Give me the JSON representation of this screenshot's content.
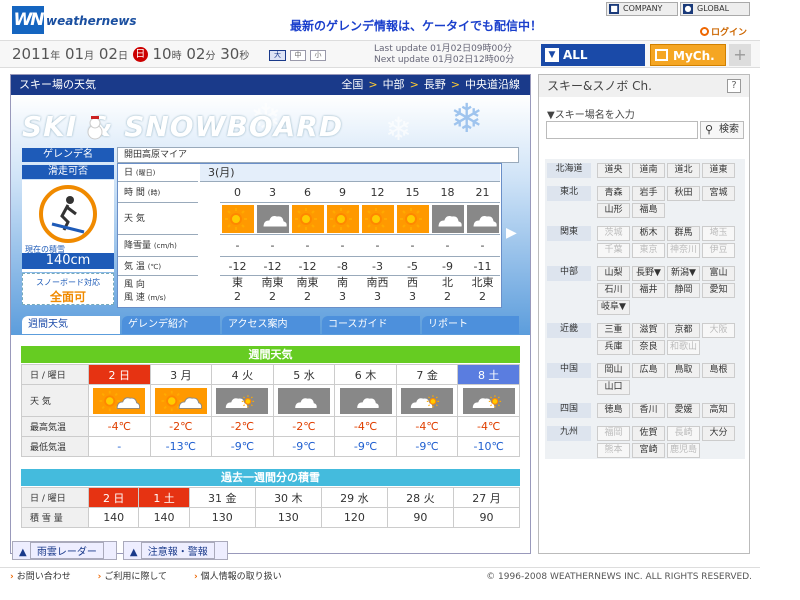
{
  "header": {
    "logo_mark": "WN",
    "logo_text": "weathernews",
    "promo": "最新のゲレンデ情報は、ケータイでも配信中！",
    "company": "COMPANY",
    "global": "GLOBAL",
    "login": "ログイン"
  },
  "datebar": {
    "year": "2011",
    "y_unit": "年",
    "month": "01",
    "m_unit": "月",
    "day": "02",
    "d_unit": "日",
    "weekday": "日",
    "hour": "10",
    "h_unit": "時",
    "minute": "02",
    "mi_unit": "分",
    "second": "30",
    "s_unit": "秒",
    "sizes": [
      "大",
      "中",
      "小"
    ],
    "last_update": "Last update  01月02日09時00分",
    "next_update": "Next update  01月02日12時00分",
    "all_channel": "ALL Channel",
    "mych": "MyCh.",
    "plus": "+"
  },
  "main": {
    "title": "スキー場の天気",
    "crumbs": [
      "全国",
      "中部",
      "長野",
      "中央道沿線"
    ],
    "crumb_sep": ">",
    "banner_title": "SKI & SNOWBOARD",
    "gelande_label": "ゲレンデ名",
    "gelande_name": "開田高原マイア",
    "status_label": "滑走可否",
    "snow_depth_label": "現在の積雪",
    "snow_depth": "140cm",
    "snowboard_label": "スノーボード対応",
    "snowboard_status": "全面可",
    "date_label": "日",
    "date_label_sub": "(曜日)",
    "date_value": "3(月)",
    "time_label": "時 間",
    "time_label_sub": "(時)",
    "hours": [
      "0",
      "3",
      "6",
      "9",
      "12",
      "15",
      "18",
      "21"
    ],
    "weather_label": "天 気",
    "weather": [
      "sunny-icon",
      "cloudy-icon",
      "sunny-icon",
      "sunny-icon",
      "sunny-icon",
      "sunny-icon",
      "cloudy-icon",
      "cloudy-icon"
    ],
    "precip_label": "降雪量",
    "precip_unit": "(cm/h)",
    "precip": [
      "-",
      "-",
      "-",
      "-",
      "-",
      "-",
      "-",
      "-"
    ],
    "temp_label": "気 温",
    "temp_unit": "(℃)",
    "temps": [
      "-12",
      "-12",
      "-12",
      "-8",
      "-3",
      "-5",
      "-9",
      "-11"
    ],
    "wind_dir_label": "風 向",
    "wind_speed_label": "風 速",
    "wind_unit": "(m/s)",
    "wind_dir": [
      "東",
      "南東",
      "南東",
      "南",
      "南西",
      "西",
      "北",
      "北東"
    ],
    "wind_speed": [
      "2",
      "2",
      "2",
      "3",
      "3",
      "3",
      "2",
      "2"
    ],
    "tabs": [
      "週間天気",
      "ゲレンデ紹介",
      "アクセス案内",
      "コースガイド",
      "リポート"
    ]
  },
  "weekly": {
    "title": "週間天気",
    "day_label": "日 / 曜日",
    "days": [
      "2 日",
      "3 月",
      "4 火",
      "5 水",
      "6 木",
      "7 金",
      "8 土"
    ],
    "weather_label": "天 気",
    "weather": [
      "sunny-then-cloudy-icon",
      "sunny-then-cloudy-icon",
      "cloudy-then-sunny-icon",
      "cloudy-icon",
      "cloudy-icon",
      "cloudy-then-sunny-icon",
      "cloudy-then-sunny-icon"
    ],
    "max_label": "最高気温",
    "max": [
      "-4℃",
      "-2℃",
      "-2℃",
      "-2℃",
      "-4℃",
      "-4℃",
      "-4℃"
    ],
    "min_label": "最低気温",
    "min": [
      "-",
      "-13℃",
      "-9℃",
      "-9℃",
      "-9℃",
      "-9℃",
      "-10℃"
    ]
  },
  "past": {
    "title": "過去一週間分の積雪",
    "day_label": "日 / 曜日",
    "days": [
      "2 日",
      "1 土",
      "31 金",
      "30 木",
      "29 水",
      "28 火",
      "27 月"
    ],
    "snow_label": "積 雪 量",
    "snow": [
      "140",
      "140",
      "130",
      "130",
      "120",
      "90",
      "90"
    ]
  },
  "bottom_links": [
    "雨雲レーダー",
    "注意報・警報"
  ],
  "footer": {
    "links": [
      "お問い合わせ",
      "ご利用に際して",
      "個人情報の取り扱い"
    ],
    "copyright": "© 1996-2008 WEATHERNEWS INC. ALL RIGHTS RESERVED."
  },
  "side": {
    "title": "スキー&スノボ Ch.",
    "help": "?",
    "search_label": "▼スキー場名を入力",
    "search_button": "検索",
    "regions": [
      {
        "name": "北海道",
        "items": [
          {
            "t": "道央"
          },
          {
            "t": "道南"
          },
          {
            "t": "道北"
          },
          {
            "t": "道東"
          }
        ]
      },
      {
        "name": "東北",
        "items": [
          {
            "t": "青森"
          },
          {
            "t": "岩手"
          },
          {
            "t": "秋田"
          },
          {
            "t": "宮城"
          },
          {
            "t": "山形"
          },
          {
            "t": "福島"
          }
        ]
      },
      {
        "name": "関東",
        "items": [
          {
            "t": "茨城",
            "dim": true
          },
          {
            "t": "栃木"
          },
          {
            "t": "群馬"
          },
          {
            "t": "埼玉",
            "dim": true
          },
          {
            "t": "千葉",
            "dim": true
          },
          {
            "t": "東京",
            "dim": true
          },
          {
            "t": "神奈川",
            "dim": true
          },
          {
            "t": "伊豆",
            "dim": true
          }
        ]
      },
      {
        "name": "中部",
        "items": [
          {
            "t": "山梨"
          },
          {
            "t": "長野▼"
          },
          {
            "t": "新潟▼"
          },
          {
            "t": "富山"
          },
          {
            "t": "石川"
          },
          {
            "t": "福井"
          },
          {
            "t": "静岡"
          },
          {
            "t": "愛知"
          },
          {
            "t": "岐阜▼"
          }
        ]
      },
      {
        "name": "近畿",
        "items": [
          {
            "t": "三重"
          },
          {
            "t": "滋賀"
          },
          {
            "t": "京都"
          },
          {
            "t": "大阪",
            "dim": true
          },
          {
            "t": "兵庫"
          },
          {
            "t": "奈良"
          },
          {
            "t": "和歌山",
            "dim": true
          }
        ]
      },
      {
        "name": "中国",
        "items": [
          {
            "t": "岡山"
          },
          {
            "t": "広島"
          },
          {
            "t": "鳥取"
          },
          {
            "t": "島根"
          },
          {
            "t": "山口"
          }
        ]
      },
      {
        "name": "四国",
        "items": [
          {
            "t": "徳島"
          },
          {
            "t": "香川"
          },
          {
            "t": "愛媛"
          },
          {
            "t": "高知"
          }
        ]
      },
      {
        "name": "九州",
        "items": [
          {
            "t": "福岡",
            "dim": true
          },
          {
            "t": "佐賀"
          },
          {
            "t": "長崎",
            "dim": true
          },
          {
            "t": "大分"
          },
          {
            "t": "熊本",
            "dim": true
          },
          {
            "t": "宮崎"
          },
          {
            "t": "鹿児島",
            "dim": true
          }
        ]
      }
    ]
  }
}
